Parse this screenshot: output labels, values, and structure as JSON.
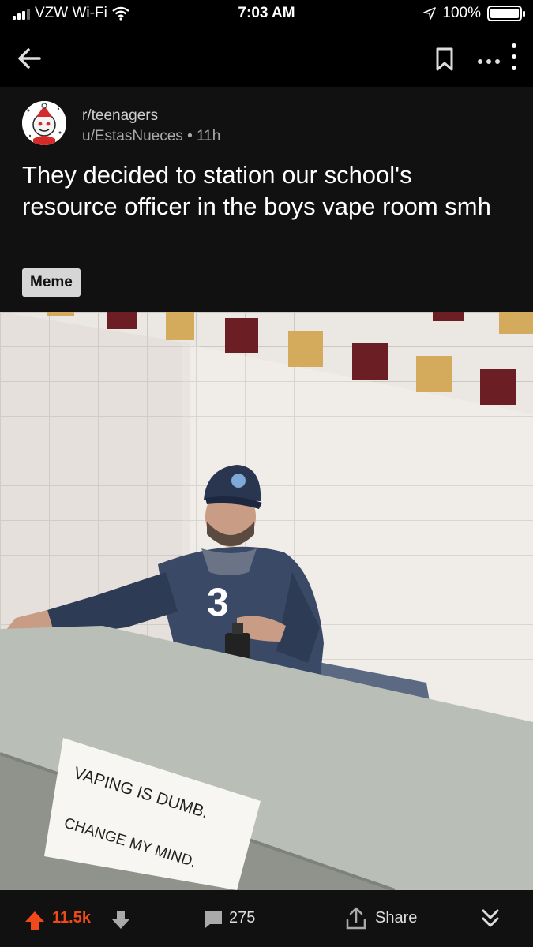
{
  "status_bar": {
    "carrier": "VZW Wi-Fi",
    "time": "7:03 AM",
    "battery": "100%",
    "icons": [
      "signal-icon",
      "wifi-icon",
      "location-icon",
      "battery-icon"
    ]
  },
  "nav": {
    "icons": [
      "back-arrow-icon",
      "bookmark-icon",
      "more-options-icon"
    ]
  },
  "post": {
    "subreddit": "r/teenagers",
    "author": "u/EstasNueces",
    "age": "11h",
    "title": "They decided to station our school's resource officer in the boys vape room smh",
    "flair": "Meme",
    "image_sign": {
      "line1": "VAPING IS DUMB.",
      "line2": "CHANGE MY MIND.",
      "jersey_number": "3"
    }
  },
  "actions": {
    "score": "11.5k",
    "comments": "275",
    "share_label": "Share",
    "accent_color": "#f04a1a",
    "icons": [
      "upvote-icon",
      "downvote-icon",
      "comment-icon",
      "share-icon",
      "collapse-icon"
    ]
  }
}
